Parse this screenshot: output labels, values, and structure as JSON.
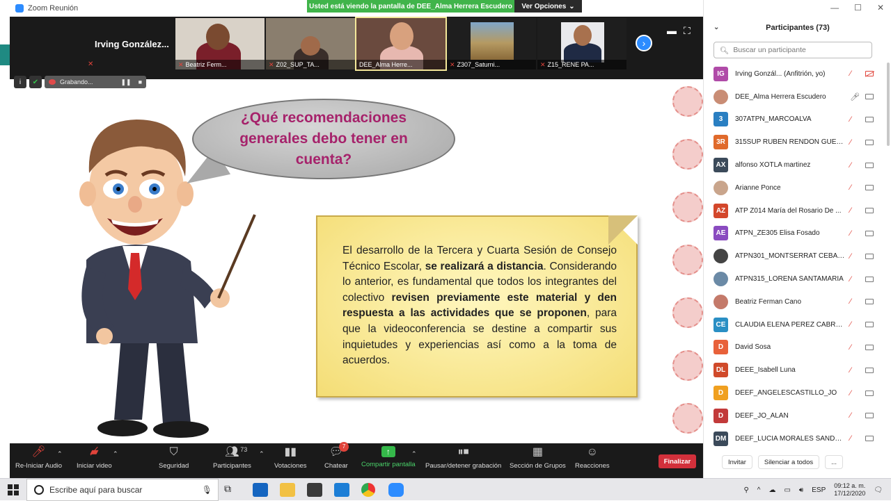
{
  "window": {
    "title": "Zoom Reunión"
  },
  "share_banner": {
    "text": "Usted está viendo la pantalla de DEE_Alma Herrera Escudero",
    "options_label": "Ver Opciones"
  },
  "video_strip": {
    "first_name": "Irving  González...",
    "tiles": [
      {
        "name": "Beatriz Ferm..."
      },
      {
        "name": "Z02_SUP_TA..."
      },
      {
        "name": "DEE_Alma Herre..."
      },
      {
        "name": "Z307_Saturni..."
      },
      {
        "name": "Z15_RENE PA..."
      }
    ]
  },
  "recording": {
    "label": "Grabando..."
  },
  "slide": {
    "question": "¿Qué recomendaciones generales debo tener en cuenta?",
    "note_parts": [
      "El desarrollo de la Tercera y Cuarta Sesión de Consejo Técnico Escolar, ",
      "se realizará a distancia",
      ". Considerando lo anterior, es fundamental que todos los integrantes del colectivo ",
      "revisen previamente este material y den respuesta a las actividades que se proponen",
      ", para que la videoconferencia se destine a compartir sus inquietudes y experiencias así como a la toma de acuerdos."
    ]
  },
  "toolbar": {
    "audio": "Re-Iniciar Audio",
    "video": "Iniciar video",
    "security": "Seguridad",
    "participants": "Participantes",
    "participants_count": "73",
    "polls": "Votaciones",
    "chat": "Chatear",
    "chat_badge": "7",
    "share": "Compartir pantalla",
    "record": "Pausar/detener grabación",
    "breakout": "Sección de Grupos",
    "reactions": "Reacciones",
    "end": "Finalizar"
  },
  "panel": {
    "title": "Participantes (73)",
    "search_placeholder": "Buscar un participante",
    "participants": [
      {
        "initials": "IG",
        "color": "#b04ba8",
        "name": "Irving Gonzál...  (Anfitrión, yo)"
      },
      {
        "initials": "",
        "color": "#c98d75",
        "name": "DEE_Alma Herrera Escudero"
      },
      {
        "initials": "3",
        "color": "#2a7fc2",
        "name": "307ATPN_MARCOALVA"
      },
      {
        "initials": "3R",
        "color": "#e06a2b",
        "name": "315SUP RUBEN RENDON GUER..."
      },
      {
        "initials": "AX",
        "color": "#3b4a5a",
        "name": "alfonso XOTLA martinez"
      },
      {
        "initials": "",
        "color": "#c9a58c",
        "name": "Arianne Ponce"
      },
      {
        "initials": "AZ",
        "color": "#d3472b",
        "name": "ATP Z014 María del Rosario De ..."
      },
      {
        "initials": "AE",
        "color": "#8a4bc0",
        "name": "ATPN_ZE305 Elisa Fosado"
      },
      {
        "initials": "",
        "color": "#444444",
        "name": "ATPN301_MONTSERRAT CEBALL..."
      },
      {
        "initials": "",
        "color": "#6b8aa6",
        "name": "ATPN315_LORENA SANTAMARIA"
      },
      {
        "initials": "",
        "color": "#c47a6a",
        "name": "Beatriz Ferman Cano"
      },
      {
        "initials": "CE",
        "color": "#2a8fc4",
        "name": "CLAUDIA ELENA PEREZ CABRER..."
      },
      {
        "initials": "D",
        "color": "#e8613a",
        "name": "David Sosa"
      },
      {
        "initials": "DL",
        "color": "#d04a2a",
        "name": "DEEE_Isabell Luna"
      },
      {
        "initials": "D",
        "color": "#f0a020",
        "name": "DEEF_ANGELESCASTILLO_JO"
      },
      {
        "initials": "D",
        "color": "#c23a3a",
        "name": "DEEF_JO_ALAN"
      },
      {
        "initials": "DM",
        "color": "#3b4a5a",
        "name": "DEEF_LUCIA MORALES SANDOV..."
      }
    ],
    "invite": "Invitar",
    "mute_all": "Silenciar a todos",
    "more": "..."
  },
  "taskbar": {
    "search_placeholder": "Escribe aquí para buscar",
    "lang": "ESP",
    "time": "09:12 a. m.",
    "date": "17/12/2020"
  }
}
